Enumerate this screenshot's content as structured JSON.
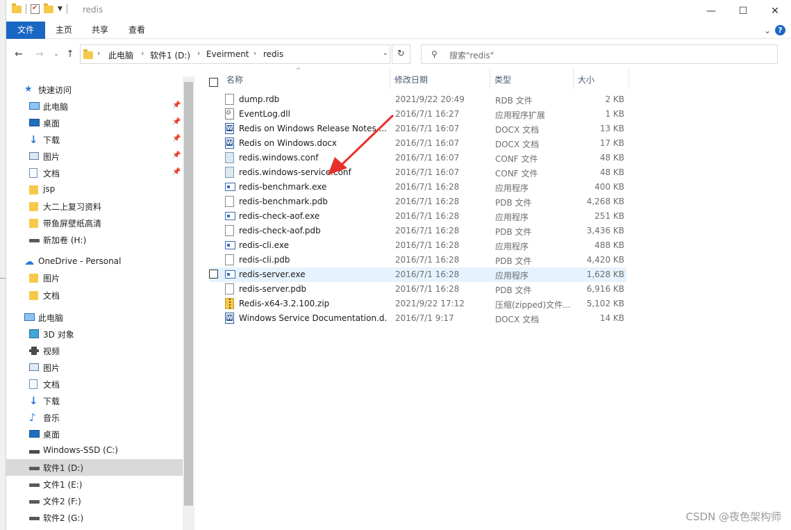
{
  "window": {
    "title": "redis",
    "controls": {
      "minimize": "—",
      "maximize": "☐",
      "close": "✕"
    }
  },
  "ribbon": {
    "tabs": [
      "文件",
      "主页",
      "共享",
      "查看"
    ],
    "help_label": "?"
  },
  "address": {
    "crumbs": [
      "此电脑",
      "软件1 (D:)",
      "Eveirment",
      "redis"
    ],
    "search_placeholder": "搜索\"redis\""
  },
  "sidebar": {
    "items": [
      {
        "label": "快速访问",
        "icon": "star-icon",
        "pinned": false
      },
      {
        "label": "此电脑",
        "icon": "pc-icon",
        "pinned": true
      },
      {
        "label": "桌面",
        "icon": "desktop-icon",
        "pinned": true
      },
      {
        "label": "下载",
        "icon": "download-icon",
        "pinned": true
      },
      {
        "label": "图片",
        "icon": "pictures-icon",
        "pinned": true
      },
      {
        "label": "文档",
        "icon": "documents-icon",
        "pinned": true
      },
      {
        "label": "jsp",
        "icon": "folder-icon",
        "pinned": false
      },
      {
        "label": "大二上复习资料",
        "icon": "folder-icon",
        "pinned": false
      },
      {
        "label": "带鱼屏壁纸高清",
        "icon": "folder-icon",
        "pinned": false
      },
      {
        "label": "新加卷 (H:)",
        "icon": "drive-icon",
        "pinned": false
      },
      {
        "label": "OneDrive - Personal",
        "icon": "cloud-icon",
        "pinned": false
      },
      {
        "label": "图片",
        "icon": "folder-icon",
        "pinned": false
      },
      {
        "label": "文档",
        "icon": "folder-icon",
        "pinned": false
      },
      {
        "label": "此电脑",
        "icon": "pc-icon",
        "pinned": false
      },
      {
        "label": "3D 对象",
        "icon": "3d-objects-icon",
        "pinned": false
      },
      {
        "label": "视频",
        "icon": "video-icon",
        "pinned": false
      },
      {
        "label": "图片",
        "icon": "pictures-icon",
        "pinned": false
      },
      {
        "label": "文档",
        "icon": "documents-icon",
        "pinned": false
      },
      {
        "label": "下载",
        "icon": "download-icon",
        "pinned": false
      },
      {
        "label": "音乐",
        "icon": "music-icon",
        "pinned": false
      },
      {
        "label": "桌面",
        "icon": "desktop-icon",
        "pinned": false
      },
      {
        "label": "Windows-SSD (C:)",
        "icon": "windows-drive-icon",
        "pinned": false
      },
      {
        "label": "软件1 (D:)",
        "icon": "drive-icon",
        "pinned": false,
        "selected": true
      },
      {
        "label": "文件1 (E:)",
        "icon": "drive-icon",
        "pinned": false
      },
      {
        "label": "文件2 (F:)",
        "icon": "drive-icon",
        "pinned": false
      },
      {
        "label": "软件2 (G:)",
        "icon": "drive-icon",
        "pinned": false
      }
    ]
  },
  "columns": {
    "name": "名称",
    "date": "修改日期",
    "type": "类型",
    "size": "大小"
  },
  "files": [
    {
      "name": "dump.rdb",
      "date": "2021/9/22 20:49",
      "type": "RDB 文件",
      "size": "2 KB",
      "kind": "file"
    },
    {
      "name": "EventLog.dll",
      "date": "2016/7/1 16:27",
      "type": "应用程序扩展",
      "size": "1 KB",
      "kind": "dll"
    },
    {
      "name": "Redis on Windows Release Notes....",
      "date": "2016/7/1 16:07",
      "type": "DOCX 文档",
      "size": "13 KB",
      "kind": "docx"
    },
    {
      "name": "Redis on Windows.docx",
      "date": "2016/7/1 16:07",
      "type": "DOCX 文档",
      "size": "17 KB",
      "kind": "docx"
    },
    {
      "name": "redis.windows.conf",
      "date": "2016/7/1 16:07",
      "type": "CONF 文件",
      "size": "48 KB",
      "kind": "conf"
    },
    {
      "name": "redis.windows-service.conf",
      "date": "2016/7/1 16:07",
      "type": "CONF 文件",
      "size": "48 KB",
      "kind": "conf"
    },
    {
      "name": "redis-benchmark.exe",
      "date": "2016/7/1 16:28",
      "type": "应用程序",
      "size": "400 KB",
      "kind": "exe"
    },
    {
      "name": "redis-benchmark.pdb",
      "date": "2016/7/1 16:28",
      "type": "PDB 文件",
      "size": "4,268 KB",
      "kind": "file"
    },
    {
      "name": "redis-check-aof.exe",
      "date": "2016/7/1 16:28",
      "type": "应用程序",
      "size": "251 KB",
      "kind": "exe"
    },
    {
      "name": "redis-check-aof.pdb",
      "date": "2016/7/1 16:28",
      "type": "PDB 文件",
      "size": "3,436 KB",
      "kind": "file"
    },
    {
      "name": "redis-cli.exe",
      "date": "2016/7/1 16:28",
      "type": "应用程序",
      "size": "488 KB",
      "kind": "exe"
    },
    {
      "name": "redis-cli.pdb",
      "date": "2016/7/1 16:28",
      "type": "PDB 文件",
      "size": "4,420 KB",
      "kind": "file"
    },
    {
      "name": "redis-server.exe",
      "date": "2016/7/1 16:28",
      "type": "应用程序",
      "size": "1,628 KB",
      "kind": "exe",
      "hovered": true
    },
    {
      "name": "redis-server.pdb",
      "date": "2016/7/1 16:28",
      "type": "PDB 文件",
      "size": "6,916 KB",
      "kind": "file"
    },
    {
      "name": "Redis-x64-3.2.100.zip",
      "date": "2021/9/22 17:12",
      "type": "压缩(zipped)文件...",
      "size": "5,102 KB",
      "kind": "zip"
    },
    {
      "name": "Windows Service Documentation.d...",
      "date": "2016/7/1 9:17",
      "type": "DOCX 文档",
      "size": "14 KB",
      "kind": "docx"
    }
  ],
  "colors": {
    "accent": "#1a67c3",
    "hover_row": "#e5f3ff",
    "selected_nav": "#d9d9d9",
    "arrow": "#e8302a"
  },
  "watermark": "CSDN @夜色架构师"
}
